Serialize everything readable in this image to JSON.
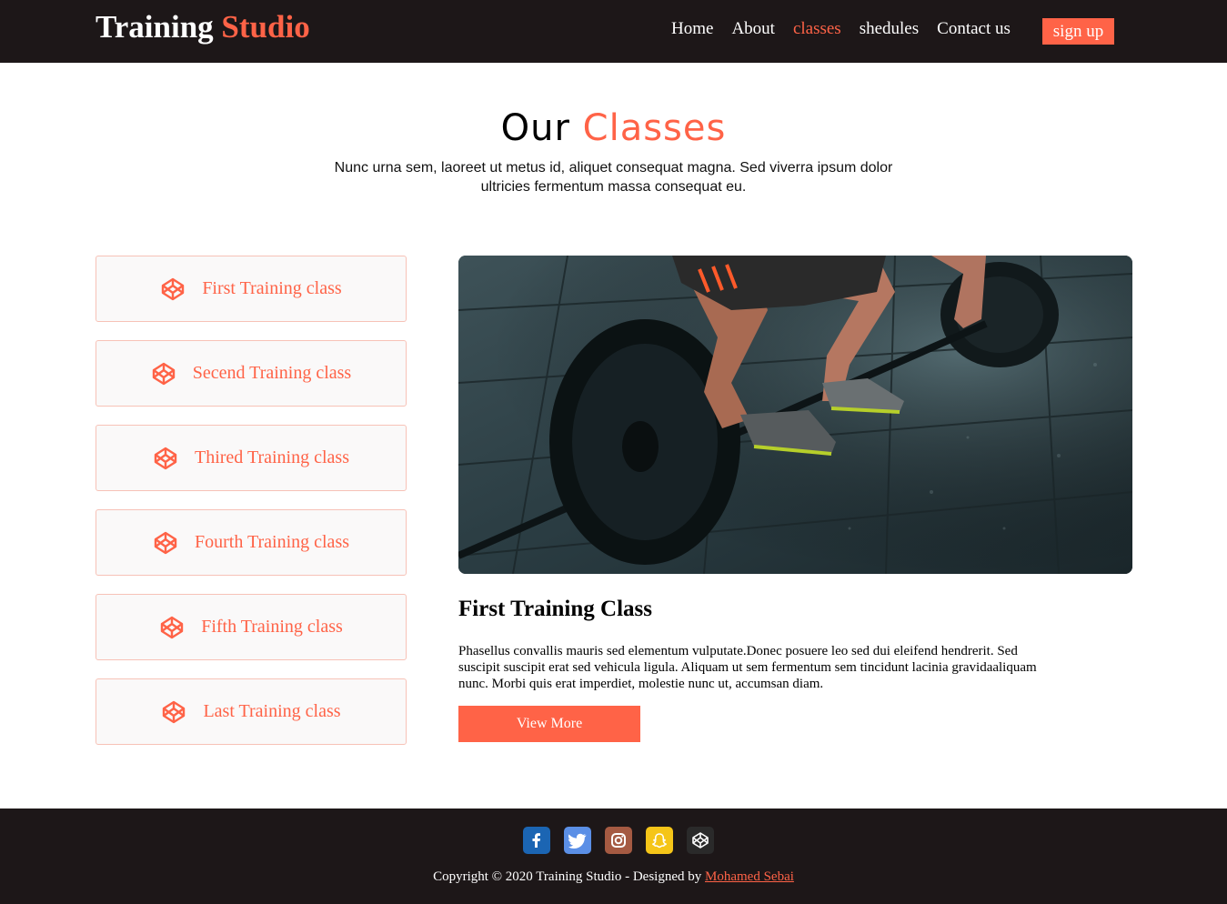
{
  "brand": {
    "part1": "Training",
    "part2": "Studio"
  },
  "nav": {
    "items": [
      "Home",
      "About",
      "classes",
      "shedules",
      "Contact us"
    ],
    "active_index": 2,
    "signup": "sign up"
  },
  "section": {
    "title_part1": "Our",
    "title_part2": "Classes",
    "subtitle": "Nunc urna sem, laoreet ut metus id, aliquet consequat magna. Sed viverra ipsum dolor ultricies fermentum massa consequat eu."
  },
  "classes": [
    {
      "label": "First Training class",
      "icon": "codepen-icon"
    },
    {
      "label": "Secend Training class",
      "icon": "codepen-icon"
    },
    {
      "label": "Thired Training class",
      "icon": "codepen-icon"
    },
    {
      "label": "Fourth Training class",
      "icon": "codepen-icon"
    },
    {
      "label": "Fifth Training class",
      "icon": "codepen-icon"
    },
    {
      "label": "Last Training class",
      "icon": "codepen-icon"
    }
  ],
  "detail": {
    "image": "weightlifter-barbell-photo",
    "title": "First Training Class",
    "description": "Phasellus convallis mauris sed elementum vulputate.Donec posuere leo sed dui eleifend hendrerit. Sed suscipit suscipit erat sed vehicula ligula. Aliquam ut sem fermentum sem tincidunt lacinia gravidaaliquam nunc. Morbi quis erat imperdiet, molestie nunc ut, accumsan diam.",
    "button": "View More"
  },
  "footer": {
    "socials": [
      {
        "icon": "facebook-icon",
        "color": "#1b65b3"
      },
      {
        "icon": "twitter-icon",
        "color": "#5b8fe6"
      },
      {
        "icon": "instagram-icon",
        "color": "#a55a42"
      },
      {
        "icon": "snapchat-icon",
        "color": "#f5c518"
      },
      {
        "icon": "codepen-icon",
        "color": "#2a2a2a"
      }
    ],
    "copyright_text": "Copyright © 2020 Training Studio - Designed by",
    "author": "Mohamed Sebai"
  },
  "colors": {
    "accent": "#ff6347",
    "dark": "#1d1718"
  }
}
